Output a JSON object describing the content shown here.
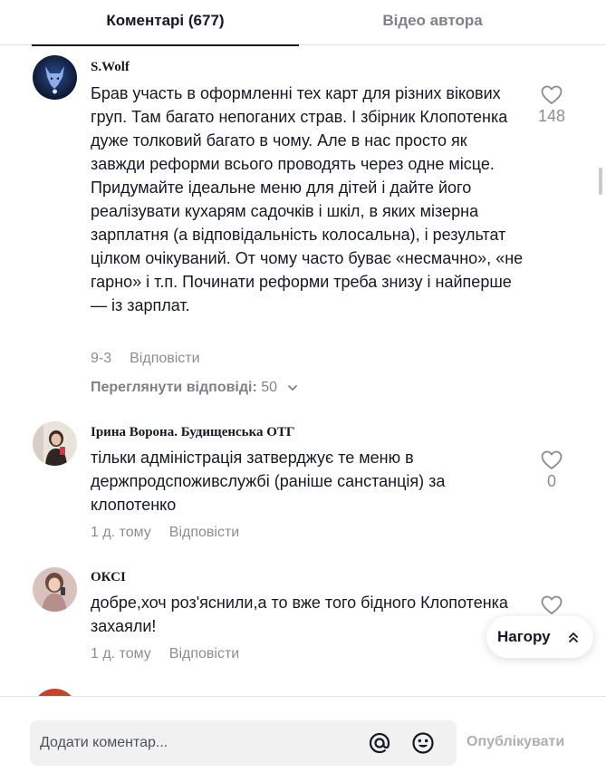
{
  "tabs": {
    "comments": "Коментарі (677)",
    "author_videos": "Відео автора"
  },
  "comments": [
    {
      "username": "S.Wolf",
      "text": "Брав участь в оформленні тех карт для різних вікових груп. Там багато непоганих страв. І збірник Клопотенка дуже толковий багато в чому. Але в нас просто як завжди реформи всього проводять через одне місце. Придумайте ідеальне меню для дітей і дайте його реалізувати кухарям садочків і шкіл, в яких мізерна зарплатня (а відповідальність колосальна), і результат цілком очікуваний. От чому часто буває «несмачно», «не гарно» і т.п. Починати реформи треба знизу і найперше — із зарплат.",
      "date": "9-3",
      "reply": "Відповісти",
      "likes": "148",
      "view_replies_label": "Переглянути відповіді:",
      "view_replies_count": "50"
    },
    {
      "username": "Ірина Ворона. Будищенська ОТГ",
      "text": "тільки адміністрація затверджує те меню в держпродспоживслужбі (раніше санстанція) за клопотенко",
      "date": "1 д. тому",
      "reply": "Відповісти",
      "likes": "0"
    },
    {
      "username": "ОКСІ",
      "text": "добре,хоч роз'яснили,а то вже того бідного Клопотенка захаяли!",
      "date": "1 д. тому",
      "reply": "Відповісти",
      "likes": ""
    }
  ],
  "to_top": "Нагору",
  "input": {
    "placeholder": "Додати коментар..."
  },
  "publish": "Опублікувати",
  "icons": [
    "heart-icon",
    "chevron-down-icon",
    "double-chevron-up-icon",
    "at-icon",
    "emoji-icon"
  ],
  "colors": {
    "text": "#161823",
    "muted": "#8a8b91",
    "input_bg": "#f1f1f2",
    "divider": "#e3e3e4"
  }
}
